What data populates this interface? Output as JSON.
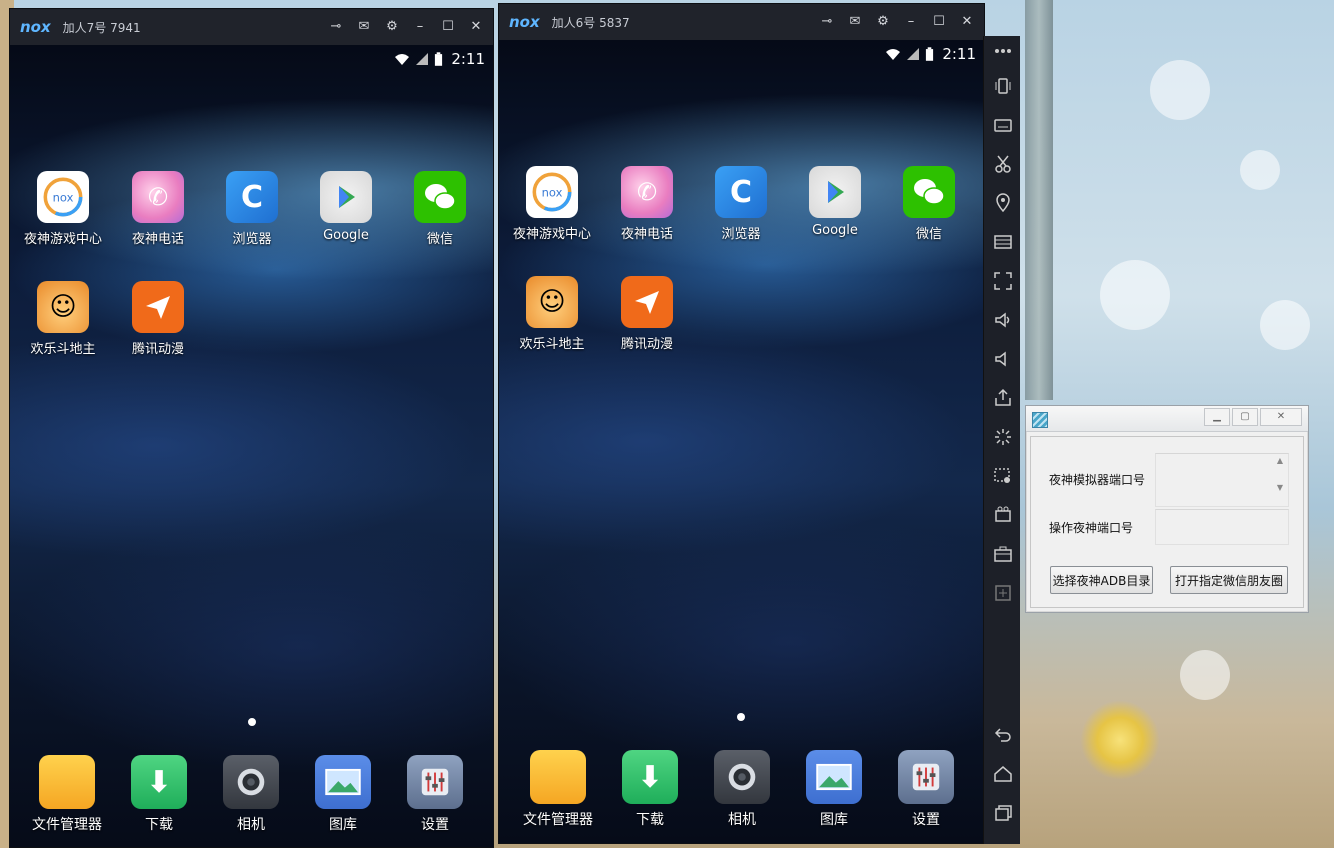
{
  "emulators": [
    {
      "title": "加人7号 7941",
      "time": "2:11",
      "apps_row1": [
        "夜神游戏中心",
        "夜神电话",
        "浏览器",
        "Google",
        "微信"
      ],
      "apps_row2": [
        "欢乐斗地主",
        "腾讯动漫"
      ],
      "dock": [
        "文件管理器",
        "下载",
        "相机",
        "图库",
        "设置"
      ]
    },
    {
      "title": "加人6号 5837",
      "time": "2:11",
      "apps_row1": [
        "夜神游戏中心",
        "夜神电话",
        "浏览器",
        "Google",
        "微信"
      ],
      "apps_row2": [
        "欢乐斗地主",
        "腾讯动漫"
      ],
      "dock": [
        "文件管理器",
        "下载",
        "相机",
        "图库",
        "设置"
      ]
    }
  ],
  "brand": {
    "logo_text": "nox",
    "accent": "#5fb6ff"
  },
  "sidebar": {
    "icons": [
      "more-icon",
      "shake-icon",
      "keyboard-icon",
      "screenshot-icon",
      "location-icon",
      "multi-instance-icon",
      "fullscreen-icon",
      "volume-up-icon",
      "volume-down-icon",
      "install-apk-icon",
      "shake-effect-icon",
      "record-icon",
      "video-icon",
      "shared-folder-icon",
      "macro-icon",
      "back-icon",
      "home-icon",
      "recent-apps-icon"
    ]
  },
  "dialog": {
    "label_port": "夜神模拟器端口号",
    "label_op_port": "操作夜神端口号",
    "port_value": "",
    "op_port_value": "",
    "btn_select_adb": "选择夜神ADB目录",
    "btn_open_moments": "打开指定微信朋友圈"
  }
}
